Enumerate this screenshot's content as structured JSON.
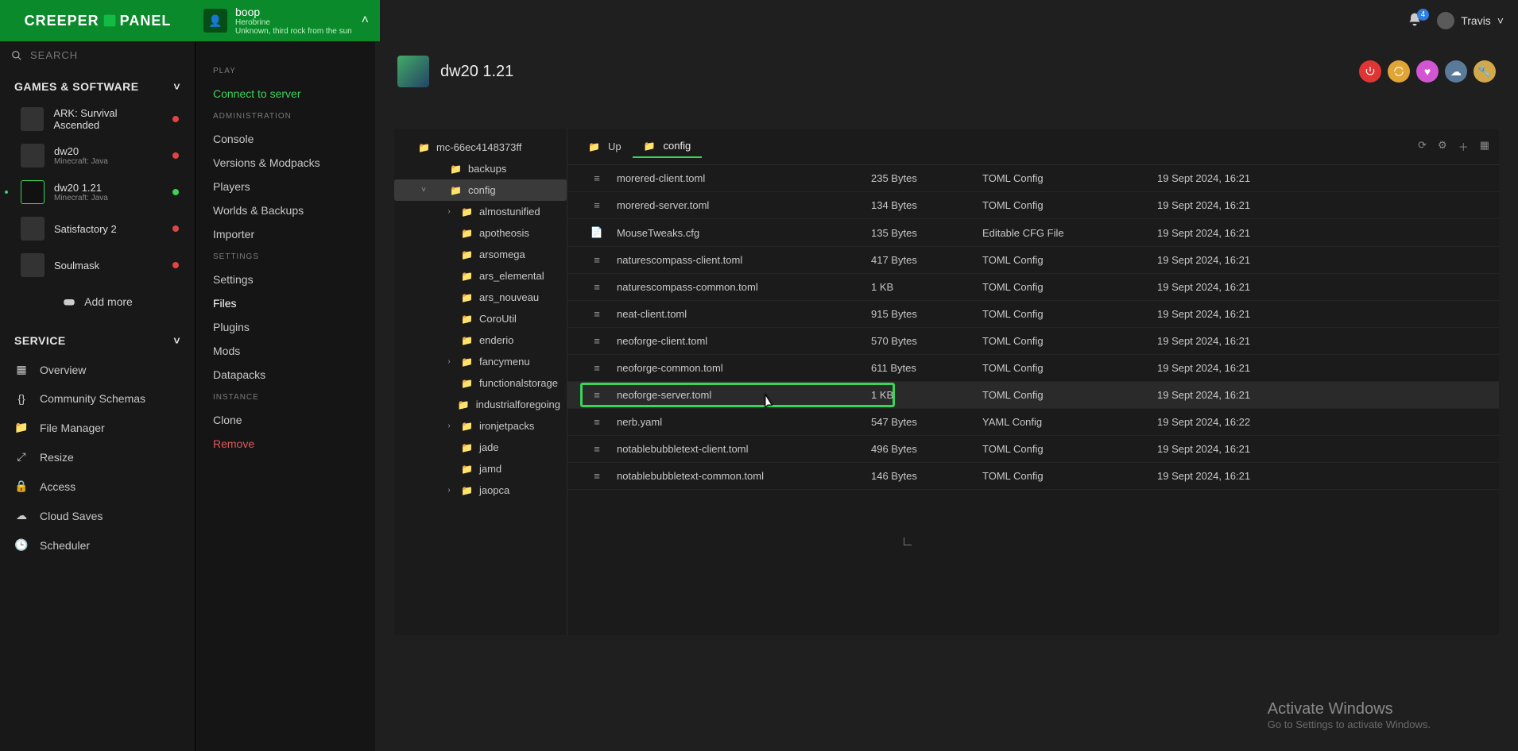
{
  "brand": "CREEPER PANEL",
  "server_chip": {
    "title": "boop",
    "sub1": "Herobrine",
    "sub2": "Unknown, third rock from the sun"
  },
  "notifications": {
    "count": "4"
  },
  "user": {
    "name": "Travis"
  },
  "search": {
    "placeholder": "SEARCH"
  },
  "sections": {
    "games": "GAMES & SOFTWARE",
    "service": "SERVICE"
  },
  "games": [
    {
      "name": "ARK: Survival Ascended",
      "sub": "",
      "status": "red",
      "active": false
    },
    {
      "name": "dw20",
      "sub": "Minecraft: Java",
      "status": "red",
      "active": false
    },
    {
      "name": "dw20 1.21",
      "sub": "Minecraft: Java",
      "status": "green",
      "active": true
    },
    {
      "name": "Satisfactory 2",
      "sub": "",
      "status": "red",
      "active": false
    },
    {
      "name": "Soulmask",
      "sub": "",
      "status": "red",
      "active": false
    }
  ],
  "add_more": "Add more",
  "service_items": [
    {
      "label": "Overview"
    },
    {
      "label": "Community Schemas"
    },
    {
      "label": "File Manager"
    },
    {
      "label": "Resize"
    },
    {
      "label": "Access"
    },
    {
      "label": "Cloud Saves"
    },
    {
      "label": "Scheduler"
    }
  ],
  "mid": {
    "play": "PLAY",
    "connect": "Connect to server",
    "admin": "ADMINISTRATION",
    "admin_items": [
      "Console",
      "Versions & Modpacks",
      "Players",
      "Worlds & Backups",
      "Importer"
    ],
    "settings": "SETTINGS",
    "settings_items": [
      "Settings",
      "Files",
      "Plugins",
      "Mods",
      "Datapacks"
    ],
    "settings_active": "Files",
    "instance": "INSTANCE",
    "instance_items": [
      "Clone",
      "Remove"
    ]
  },
  "page_title": "dw20 1.21",
  "tree_root": "mc-66ec4148373ff",
  "tree": [
    {
      "name": "backups",
      "depth": 2,
      "exp": ""
    },
    {
      "name": "config",
      "depth": 2,
      "exp": "v",
      "sel": true
    },
    {
      "name": "almostunified",
      "depth": 3,
      "exp": ">"
    },
    {
      "name": "apotheosis",
      "depth": 3,
      "exp": ""
    },
    {
      "name": "arsomega",
      "depth": 3,
      "exp": ""
    },
    {
      "name": "ars_elemental",
      "depth": 3,
      "exp": ""
    },
    {
      "name": "ars_nouveau",
      "depth": 3,
      "exp": ""
    },
    {
      "name": "CoroUtil",
      "depth": 3,
      "exp": ""
    },
    {
      "name": "enderio",
      "depth": 3,
      "exp": ""
    },
    {
      "name": "fancymenu",
      "depth": 3,
      "exp": ">"
    },
    {
      "name": "functionalstorage",
      "depth": 3,
      "exp": ""
    },
    {
      "name": "industrialforegoing",
      "depth": 3,
      "exp": ""
    },
    {
      "name": "ironjetpacks",
      "depth": 3,
      "exp": ">"
    },
    {
      "name": "jade",
      "depth": 3,
      "exp": ""
    },
    {
      "name": "jamd",
      "depth": 3,
      "exp": ""
    },
    {
      "name": "jaopca",
      "depth": 3,
      "exp": ">"
    }
  ],
  "breadcrumbs": {
    "up": "Up",
    "current": "config"
  },
  "files": [
    {
      "name": "morered-client.toml",
      "size": "235 Bytes",
      "type": "TOML Config",
      "date": "19 Sept 2024, 16:21",
      "icon": "toml"
    },
    {
      "name": "morered-server.toml",
      "size": "134 Bytes",
      "type": "TOML Config",
      "date": "19 Sept 2024, 16:21",
      "icon": "toml"
    },
    {
      "name": "MouseTweaks.cfg",
      "size": "135 Bytes",
      "type": "Editable CFG File",
      "date": "19 Sept 2024, 16:21",
      "icon": "cfg"
    },
    {
      "name": "naturescompass-client.toml",
      "size": "417 Bytes",
      "type": "TOML Config",
      "date": "19 Sept 2024, 16:21",
      "icon": "toml"
    },
    {
      "name": "naturescompass-common.toml",
      "size": "1 KB",
      "type": "TOML Config",
      "date": "19 Sept 2024, 16:21",
      "icon": "toml"
    },
    {
      "name": "neat-client.toml",
      "size": "915 Bytes",
      "type": "TOML Config",
      "date": "19 Sept 2024, 16:21",
      "icon": "toml"
    },
    {
      "name": "neoforge-client.toml",
      "size": "570 Bytes",
      "type": "TOML Config",
      "date": "19 Sept 2024, 16:21",
      "icon": "toml"
    },
    {
      "name": "neoforge-common.toml",
      "size": "611 Bytes",
      "type": "TOML Config",
      "date": "19 Sept 2024, 16:21",
      "icon": "toml"
    },
    {
      "name": "neoforge-server.toml",
      "size": "1 KB",
      "type": "TOML Config",
      "date": "19 Sept 2024, 16:21",
      "icon": "toml",
      "hl": true
    },
    {
      "name": "nerb.yaml",
      "size": "547 Bytes",
      "type": "YAML Config",
      "date": "19 Sept 2024, 16:22",
      "icon": "toml"
    },
    {
      "name": "notablebubbletext-client.toml",
      "size": "496 Bytes",
      "type": "TOML Config",
      "date": "19 Sept 2024, 16:21",
      "icon": "toml"
    },
    {
      "name": "notablebubbletext-common.toml",
      "size": "146 Bytes",
      "type": "TOML Config",
      "date": "19 Sept 2024, 16:21",
      "icon": "toml"
    }
  ],
  "watermark": {
    "t1": "Activate Windows",
    "t2": "Go to Settings to activate Windows."
  }
}
